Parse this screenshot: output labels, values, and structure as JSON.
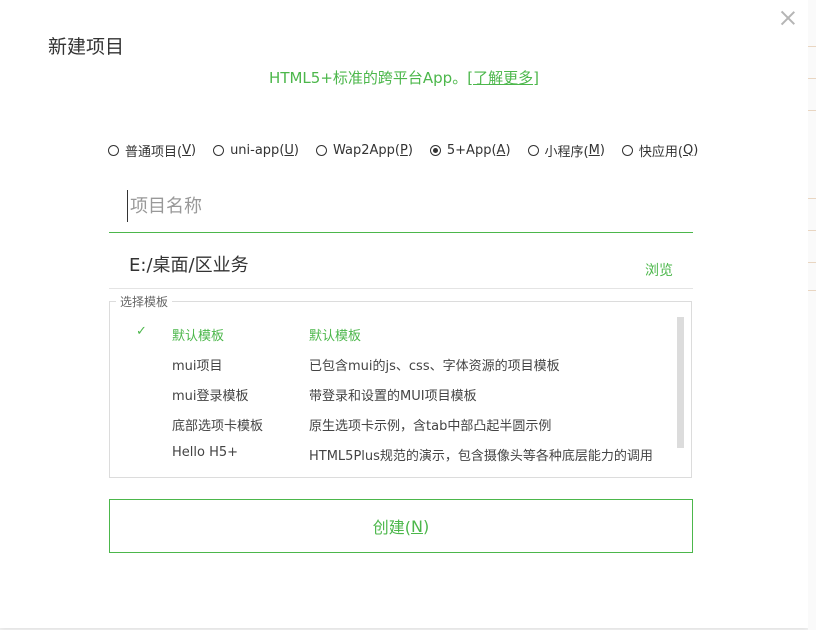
{
  "dialog": {
    "title": "新建项目",
    "subtitle_prefix": "HTML5+标准的跨平台App。",
    "subtitle_link": "[了解更多]"
  },
  "project_types": [
    {
      "label": "普通项目(",
      "key": "V",
      "suffix": ")",
      "checked": false
    },
    {
      "label": "uni-app(",
      "key": "U",
      "suffix": ")",
      "checked": false
    },
    {
      "label": "Wap2App(",
      "key": "P",
      "suffix": ")",
      "checked": false
    },
    {
      "label": "5+App(",
      "key": "A",
      "suffix": ")",
      "checked": true
    },
    {
      "label": "小程序(",
      "key": "M",
      "suffix": ")",
      "checked": false
    },
    {
      "label": "快应用(",
      "key": "Q",
      "suffix": ")",
      "checked": false
    }
  ],
  "name_field": {
    "placeholder": "项目名称",
    "value": ""
  },
  "path_field": {
    "value": "E:/桌面/区业务",
    "browse_label": "浏览"
  },
  "templates": {
    "legend": "选择模板",
    "items": [
      {
        "name": "默认模板",
        "desc": "默认模板",
        "selected": true
      },
      {
        "name": "mui项目",
        "desc": "已包含mui的js、css、字体资源的项目模板",
        "selected": false
      },
      {
        "name": "mui登录模板",
        "desc": "带登录和设置的MUI项目模板",
        "selected": false
      },
      {
        "name": "底部选项卡模板",
        "desc": "原生选项卡示例，含tab中部凸起半圆示例",
        "selected": false
      },
      {
        "name": "Hello H5+",
        "desc": "HTML5Plus规范的演示，包含摄像头等各种底层能力的调用",
        "selected": false
      }
    ]
  },
  "create_button": {
    "label": "创建(",
    "key": "N",
    "suffix": ")"
  },
  "colors": {
    "accent": "#4cb74b"
  }
}
